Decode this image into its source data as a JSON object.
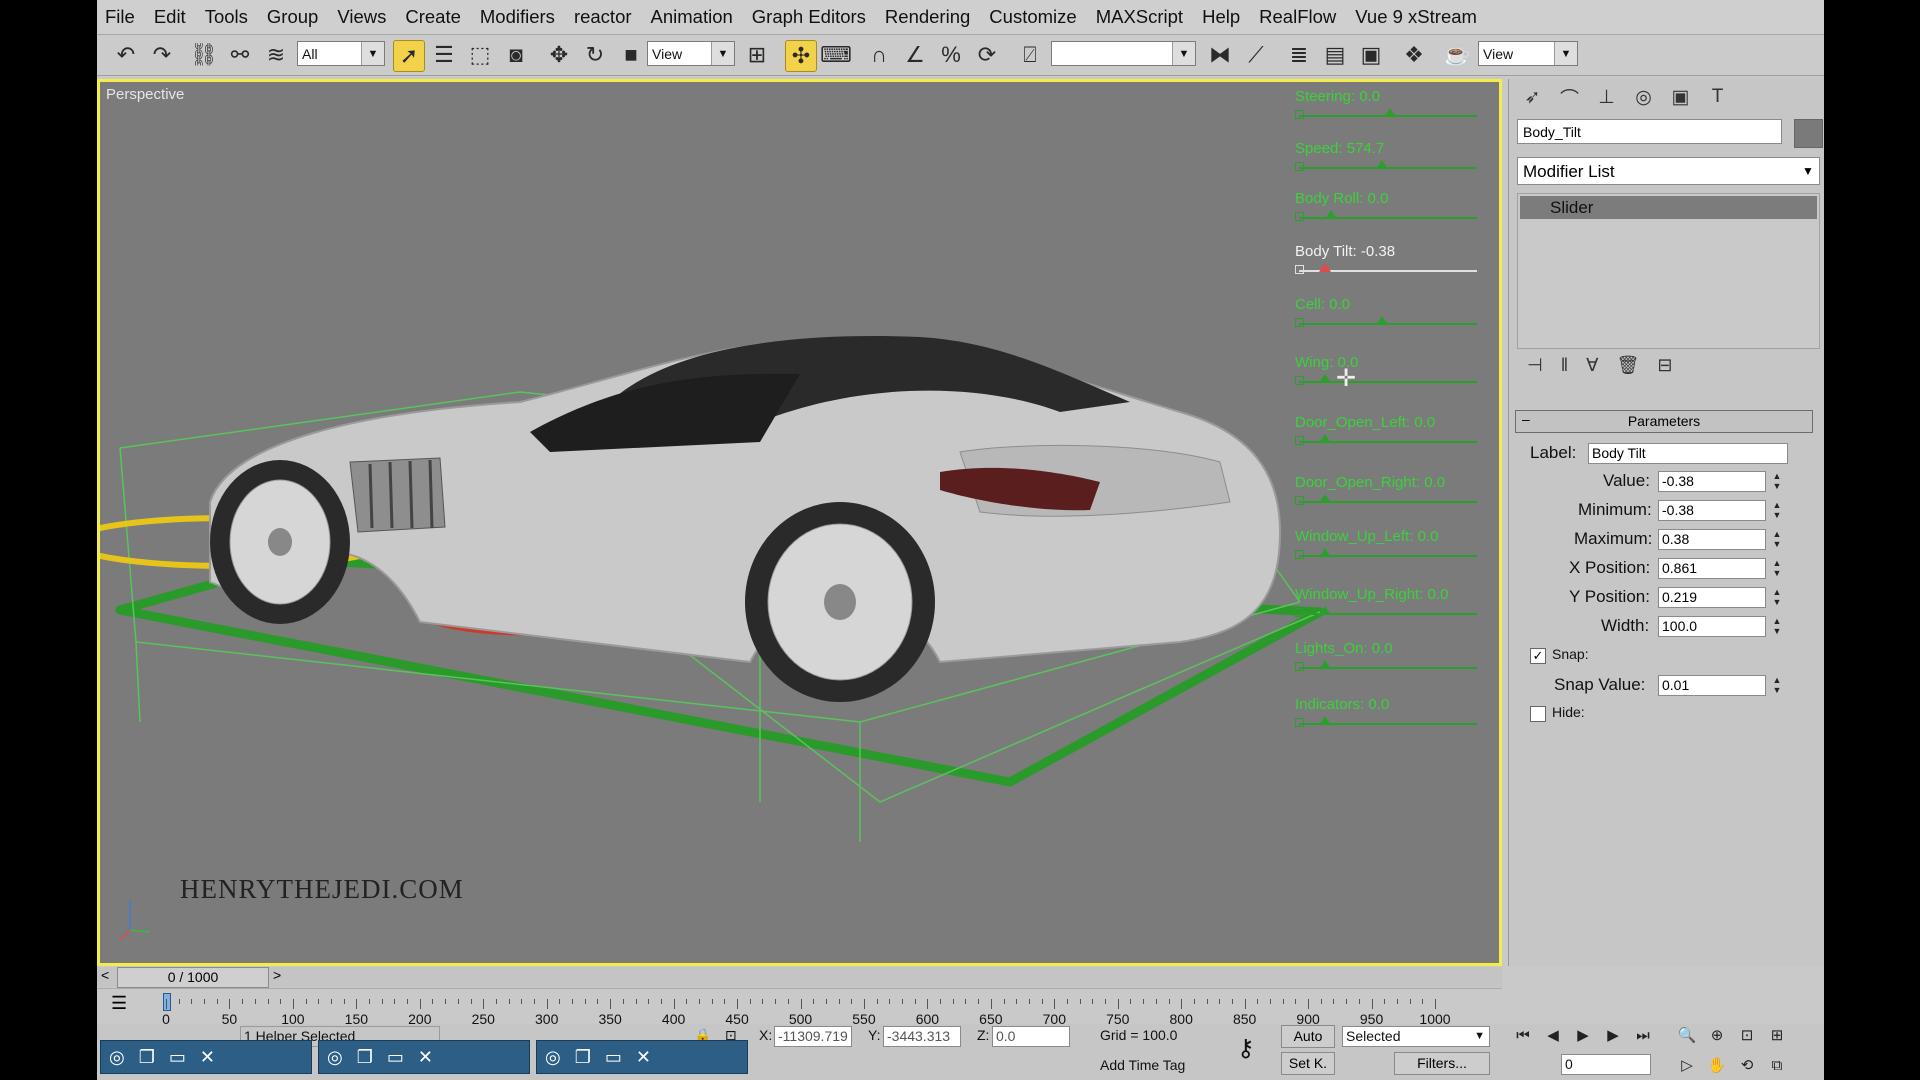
{
  "menu": [
    "File",
    "Edit",
    "Tools",
    "Group",
    "Views",
    "Create",
    "Modifiers",
    "reactor",
    "Animation",
    "Graph Editors",
    "Rendering",
    "Customize",
    "MAXScript",
    "Help",
    "RealFlow",
    "Vue 9 xStream"
  ],
  "toolbar": {
    "selection_filter": "All",
    "ref_coord": "View",
    "named_selection": "",
    "view_right": "View"
  },
  "viewport": {
    "label": "Perspective",
    "watermark": "HENRYTHEJEDI.COM",
    "sliders": [
      {
        "label": "Steering: 0.0",
        "value": 0.5
      },
      {
        "label": "Speed: 574.7",
        "value": 0.45
      },
      {
        "label": "Body Roll: 0.0",
        "value": 0.15
      },
      {
        "label": "Body Tilt: -0.38",
        "value": 0.12,
        "selected": true
      },
      {
        "label": "Cell: 0.0",
        "value": 0.45
      },
      {
        "label": "Wing: 0.0",
        "value": 0.12
      },
      {
        "label": "Door_Open_Left: 0.0",
        "value": 0.12
      },
      {
        "label": "Door_Open_Right: 0.0",
        "value": 0.12
      },
      {
        "label": "Window_Up_Left: 0.0",
        "value": 0.12
      },
      {
        "label": "Window_Up_Right: 0.0",
        "value": 0.12
      },
      {
        "label": "Lights_On: 0.0",
        "value": 0.12
      },
      {
        "label": "Indicators: 0.0",
        "value": 0.12
      }
    ]
  },
  "command_panel": {
    "object_name": "Body_Tilt",
    "modifier_list": "Modifier List",
    "stack_item": "Slider",
    "rollout_title": "Parameters",
    "params": {
      "label_caption": "Label:",
      "label_value": "Body Tilt",
      "value_caption": "Value:",
      "value": "-0.38",
      "min_caption": "Minimum:",
      "min": "-0.38",
      "max_caption": "Maximum:",
      "max": "0.38",
      "xpos_caption": "X Position:",
      "xpos": "0.861",
      "ypos_caption": "Y Position:",
      "ypos": "0.219",
      "width_caption": "Width:",
      "width": "100.0",
      "snap_caption": "Snap:",
      "snap_checked": true,
      "snapval_caption": "Snap Value:",
      "snapval": "0.01",
      "hide_caption": "Hide:",
      "hide_checked": false
    }
  },
  "timeline": {
    "frame_display": "0 / 1000",
    "ticks": [
      "0",
      "50",
      "100",
      "150",
      "200",
      "250",
      "300",
      "350",
      "400",
      "450",
      "500",
      "550",
      "600",
      "650",
      "700",
      "750",
      "800",
      "850",
      "900",
      "950",
      "1000"
    ]
  },
  "status": {
    "selection_text": "1 Helper Selected",
    "x_label": "X:",
    "x": "-11309.719",
    "y_label": "Y:",
    "y": "-3443.313",
    "z_label": "Z:",
    "z": "0.0",
    "grid": "Grid = 100.0",
    "add_time_tag": "Add Time Tag",
    "auto_key": "Auto",
    "set_key": "Set K.",
    "key_filter": "Selected",
    "filters": "Filters...",
    "frame": "0"
  }
}
